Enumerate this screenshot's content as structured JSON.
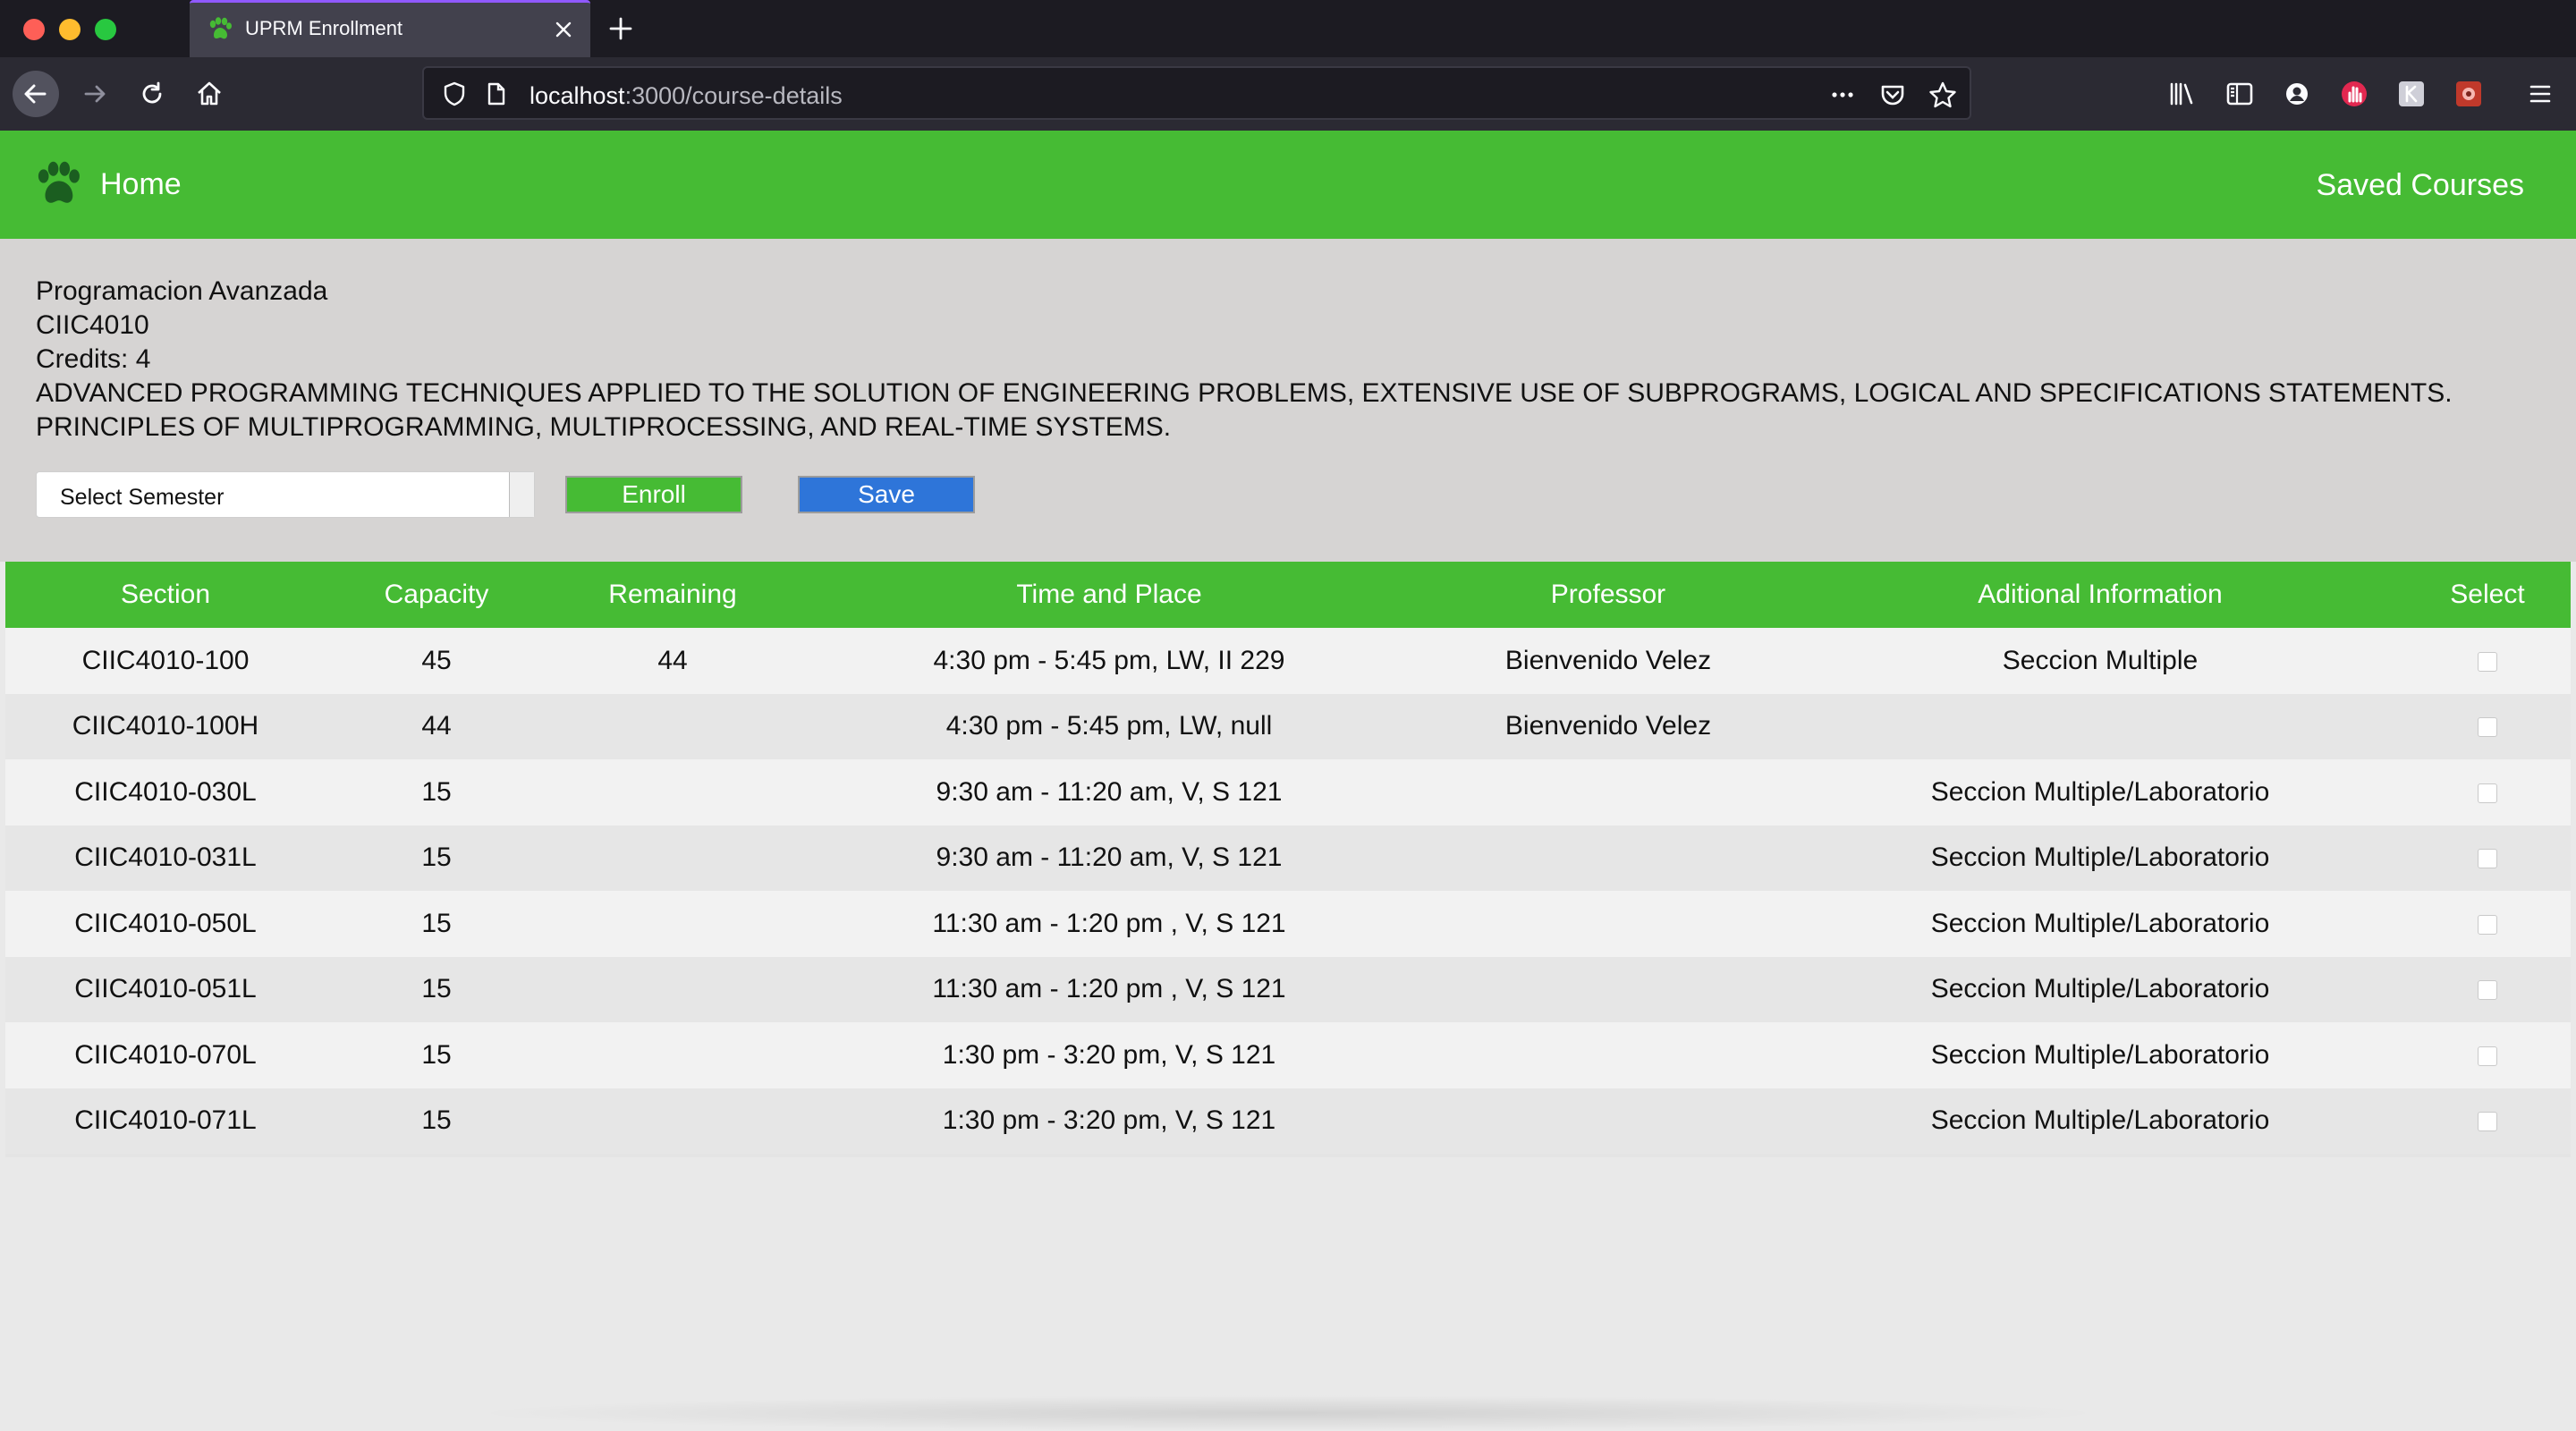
{
  "browser": {
    "tab_title": "UPRM Enrollment",
    "url_host": "localhost",
    "url_path": ":3000/course-details"
  },
  "navbar": {
    "home_label": "Home",
    "saved_label": "Saved Courses",
    "color": "#46bb34"
  },
  "course": {
    "name": "Programacion Avanzada",
    "code": "CIIC4010",
    "credits": "Credits: 4",
    "description": "ADVANCED PROGRAMMING TECHNIQUES APPLIED TO THE SOLUTION OF ENGINEERING PROBLEMS, EXTENSIVE USE OF SUBPROGRAMS, LOGICAL AND SPECIFICATIONS STATEMENTS. PRINCIPLES OF MULTIPROGRAMMING, MULTIPROCESSING, AND REAL-TIME SYSTEMS."
  },
  "controls": {
    "semester_select": "Select Semester",
    "enroll_label": "Enroll",
    "save_label": "Save"
  },
  "table": {
    "headers": [
      "Section",
      "Capacity",
      "Remaining",
      "Time and Place",
      "Professor",
      "Aditional Information",
      "Select"
    ],
    "rows": [
      [
        "CIIC4010-100",
        "45",
        "44",
        "4:30 pm - 5:45 pm, LW, II 229",
        "Bienvenido Velez",
        "Seccion Multiple"
      ],
      [
        "CIIC4010-100H",
        "44",
        "",
        "4:30 pm - 5:45 pm, LW, null",
        "Bienvenido Velez",
        ""
      ],
      [
        "CIIC4010-030L",
        "15",
        "",
        "9:30 am - 11:20 am, V, S 121",
        "",
        "Seccion Multiple/Laboratorio"
      ],
      [
        "CIIC4010-031L",
        "15",
        "",
        "9:30 am - 11:20 am, V, S 121",
        "",
        "Seccion Multiple/Laboratorio"
      ],
      [
        "CIIC4010-050L",
        "15",
        "",
        "11:30 am - 1:20 pm , V, S 121",
        "",
        "Seccion Multiple/Laboratorio"
      ],
      [
        "CIIC4010-051L",
        "15",
        "",
        "11:30 am - 1:20 pm , V, S 121",
        "",
        "Seccion Multiple/Laboratorio"
      ],
      [
        "CIIC4010-070L",
        "15",
        "",
        "1:30 pm - 3:20 pm, V, S 121",
        "",
        "Seccion Multiple/Laboratorio"
      ],
      [
        "CIIC4010-071L",
        "15",
        "",
        "1:30 pm - 3:20 pm, V, S 121",
        "",
        "Seccion Multiple/Laboratorio"
      ]
    ]
  }
}
